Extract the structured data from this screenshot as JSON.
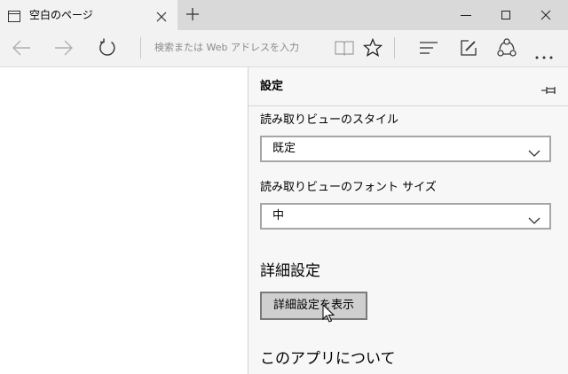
{
  "window": {
    "tab_title": "空白のページ"
  },
  "toolbar": {
    "address_placeholder": "検索または Web アドレスを入力"
  },
  "panel": {
    "title": "設定",
    "reading_view_style": {
      "label": "読み取りビューのスタイル",
      "value": "既定"
    },
    "reading_view_font_size": {
      "label": "読み取りビューのフォント サイズ",
      "value": "中"
    },
    "advanced": {
      "heading": "詳細設定",
      "button_label": "詳細設定を表示"
    },
    "about": {
      "heading": "このアプリについて"
    }
  },
  "icons": {
    "tab": "page-icon",
    "tab_close": "close-icon",
    "new_tab": "plus-icon",
    "minimize": "minimize-icon",
    "maximize": "maximize-icon",
    "close": "close-icon",
    "back": "back-arrow-icon",
    "forward": "forward-arrow-icon",
    "refresh": "refresh-icon",
    "reading_view": "book-icon",
    "favorites": "star-icon",
    "hub": "hub-icon",
    "web_note": "pen-icon",
    "share": "share-icon",
    "more": "more-icon",
    "pin": "pin-icon",
    "dropdown": "chevron-down-icon"
  },
  "colors": {
    "titlebar_bg": "#d9d9d9",
    "toolbar_bg": "#f2f2f2",
    "panel_bg": "#f7f7f7",
    "button_bg": "#cfcfcf"
  }
}
